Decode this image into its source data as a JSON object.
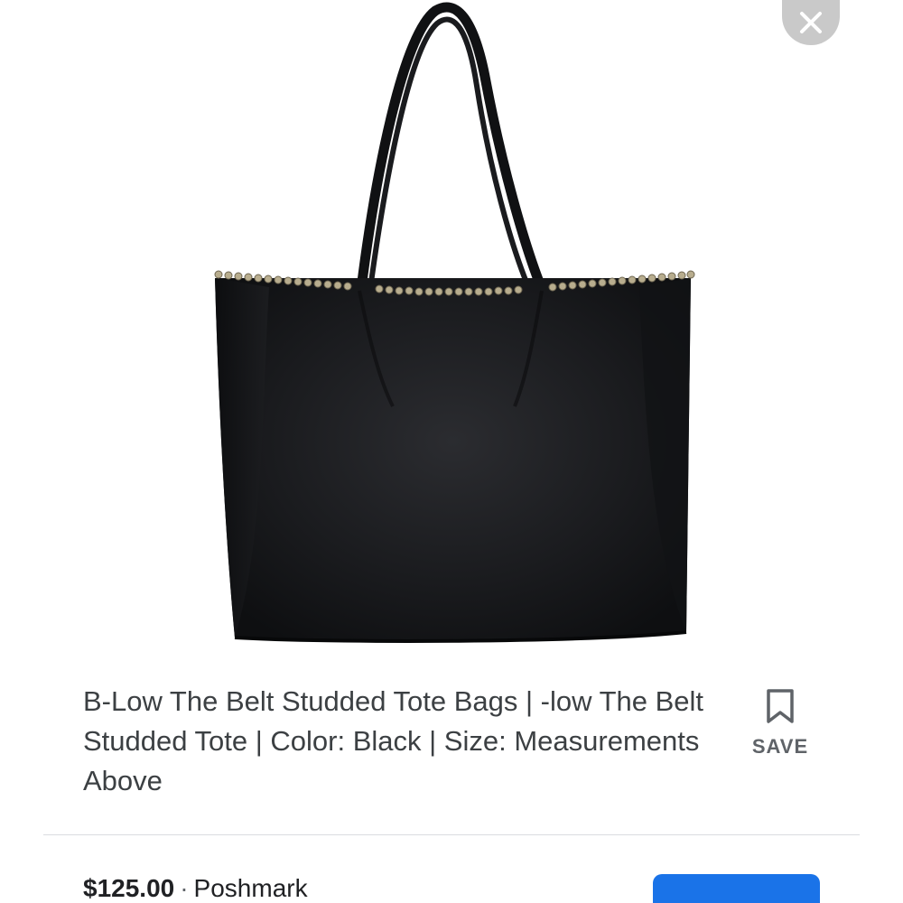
{
  "product": {
    "title": "B-Low The Belt Studded Tote Bags | -low The Belt Studded Tote | Color: Black | Size: Measurements Above",
    "image_icon": "black-studded-tote-bag-image",
    "price": "$125.00",
    "separator": "·",
    "merchant": "Poshmark"
  },
  "actions": {
    "save_label": "SAVE",
    "save_icon": "bookmark-icon",
    "close_icon": "close-icon",
    "visit_button_label": ""
  },
  "colors": {
    "accent": "#1a73e8",
    "close_bg": "#c9c9c9",
    "title_text": "#3c4043",
    "divider": "#dadce0"
  }
}
